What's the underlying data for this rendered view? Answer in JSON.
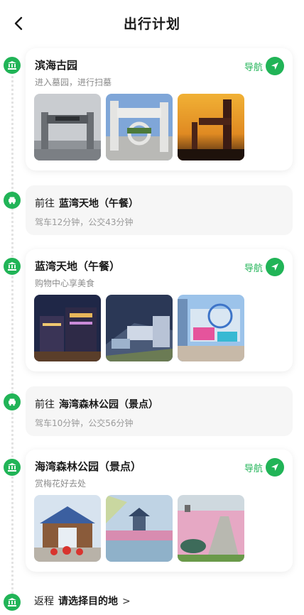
{
  "header": {
    "title": "出行计划",
    "back_icon": "chevron-left-icon"
  },
  "colors": {
    "accent": "#21b457",
    "muted": "#8c8c8c",
    "transit_bg": "#f6f6f6"
  },
  "stops": [
    {
      "name": "滨海古园",
      "desc": "进入墓园，进行扫墓",
      "nav_label": "导航",
      "photos": [
        "memorial-gate-photo",
        "stone-archway-photo",
        "sunset-gate-photo"
      ]
    },
    {
      "name": "蓝湾天地（午餐）",
      "desc": "购物中心享美食",
      "nav_label": "导航",
      "photos": [
        "night-mall-photo",
        "mall-aerial-photo",
        "mall-plaza-photo"
      ]
    },
    {
      "name": "海湾森林公园（景点）",
      "desc": "赏梅花好去处",
      "nav_label": "导航",
      "photos": [
        "park-gate-photo",
        "pagoda-lake-photo",
        "flower-field-photo"
      ]
    }
  ],
  "transits": [
    {
      "prefix": "前往",
      "dest": "蓝湾天地（午餐）",
      "info": "驾车12分钟，公交43分钟"
    },
    {
      "prefix": "前往",
      "dest": "海湾森林公园（景点）",
      "info": "驾车10分钟，公交56分钟"
    }
  ],
  "return_trip": {
    "prefix": "返程",
    "dest": "请选择目的地",
    "chevron": ">"
  }
}
